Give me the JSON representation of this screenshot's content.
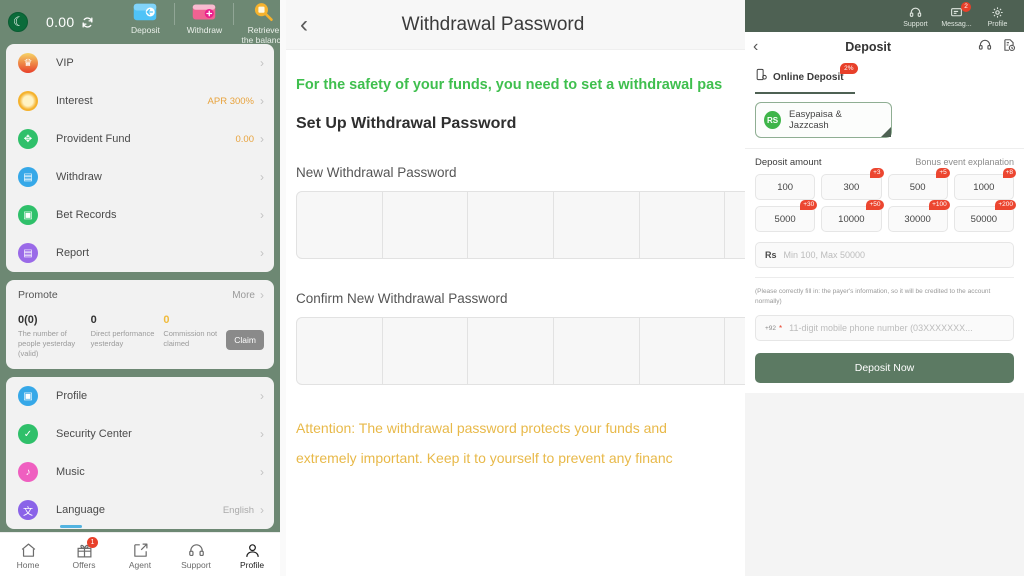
{
  "left_panel": {
    "topbar": {
      "flag_icon": "pakistan-flag-icon",
      "balance": "0.00",
      "refresh_icon": "refresh-icon",
      "actions": [
        {
          "label": "Deposit",
          "icon": "deposit-wallet-icon"
        },
        {
          "label": "Withdraw",
          "icon": "withdraw-card-icon"
        },
        {
          "label": "Retrieve\nthe balance",
          "label_line1": "Retrieve",
          "label_line2": "the balance",
          "icon": "retrieve-balance-icon"
        }
      ]
    },
    "menu_group_1": [
      {
        "label": "VIP",
        "icon": "vip-crown-icon",
        "value": "",
        "color": "#e8402a"
      },
      {
        "label": "Interest",
        "icon": "interest-coin-icon",
        "value": "APR 300%",
        "color": "#f0a93c"
      },
      {
        "label": "Provident Fund",
        "icon": "provident-fund-icon",
        "value": "0.00",
        "color": "#2fc06a"
      },
      {
        "label": "Withdraw",
        "icon": "withdraw-icon",
        "value": "",
        "color": "#36a8e8"
      },
      {
        "label": "Bet Records",
        "icon": "bet-records-icon",
        "value": "",
        "color": "#2fc06a"
      },
      {
        "label": "Report",
        "icon": "report-icon",
        "value": "",
        "color": "#9a6ae8"
      }
    ],
    "promote": {
      "title": "Promote",
      "more_label": "More",
      "stats": [
        {
          "value": "0(0)",
          "caption": "The number of people yesterday (valid)",
          "highlight": false
        },
        {
          "value": "0",
          "caption": "Direct performance yesterday",
          "highlight": false
        },
        {
          "value": "0",
          "caption": "Commission not claimed",
          "highlight": true
        }
      ],
      "claim_label": "Claim"
    },
    "menu_group_2": [
      {
        "label": "Profile",
        "icon": "profile-icon",
        "value": "",
        "color": "#36a8e8"
      },
      {
        "label": "Security Center",
        "icon": "security-shield-icon",
        "value": "",
        "color": "#2fc06a"
      },
      {
        "label": "Music",
        "icon": "music-note-icon",
        "value": "",
        "color": "#ef5fc0"
      },
      {
        "label": "Language",
        "icon": "language-icon",
        "value": "English",
        "color": "#8a63e8"
      }
    ],
    "bottom_nav": [
      {
        "label": "Home",
        "icon": "home-icon",
        "badge": "",
        "active": false
      },
      {
        "label": "Offers",
        "icon": "gift-icon",
        "badge": "1",
        "active": false
      },
      {
        "label": "Agent",
        "icon": "agent-share-icon",
        "badge": "",
        "active": false
      },
      {
        "label": "Support",
        "icon": "headset-icon",
        "badge": "",
        "active": false
      },
      {
        "label": "Profile",
        "icon": "person-icon",
        "badge": "",
        "active": true
      }
    ]
  },
  "mid_panel": {
    "back_icon": "back-chevron-icon",
    "title": "Withdrawal Password",
    "notice": "For the safety of your funds, you need to set a withdrawal pas",
    "heading": "Set Up Withdrawal Password",
    "new_password_label": "New Withdrawal Password",
    "confirm_password_label": "Confirm New Withdrawal Password",
    "otp_cells": 6,
    "warning_line1": "Attention: The withdrawal password protects your funds and",
    "warning_line2": "extremely important. Keep it to yourself to prevent any financ"
  },
  "right_panel": {
    "topbar": [
      {
        "label": "Support",
        "icon": "headset-icon",
        "badge": ""
      },
      {
        "label": "Messag...",
        "icon": "message-icon",
        "badge": "2"
      },
      {
        "label": "Profile",
        "icon": "gear-icon",
        "badge": ""
      }
    ],
    "back_icon": "back-chevron-icon",
    "title": "Deposit",
    "header_icons": [
      {
        "icon": "headset-icon"
      },
      {
        "icon": "deposit-history-icon"
      }
    ],
    "tab": {
      "label": "Online Deposit",
      "icon": "mobile-deposit-icon",
      "badge": "2%"
    },
    "method": {
      "label": "Easypaisa & Jazzcash",
      "icon": "rs-currency-icon",
      "badge": "RS",
      "selected": true
    },
    "deposit_amount_label": "Deposit amount",
    "bonus_link": "Bonus event explanation",
    "amounts": [
      {
        "value": "100",
        "bonus": ""
      },
      {
        "value": "300",
        "bonus": "+3"
      },
      {
        "value": "500",
        "bonus": "+5"
      },
      {
        "value": "1000",
        "bonus": "+8"
      },
      {
        "value": "5000",
        "bonus": "+30"
      },
      {
        "value": "10000",
        "bonus": "+50"
      },
      {
        "value": "30000",
        "bonus": "+100"
      },
      {
        "value": "50000",
        "bonus": "+200"
      }
    ],
    "amount_input": {
      "prefix": "Rs",
      "placeholder": "Min 100, Max 50000",
      "value": ""
    },
    "payer_hint": "(Please correctly fill in: the payer's information, so it will be credited to the account normally)",
    "phone_input": {
      "country_code": "+92",
      "required_mark": "*",
      "placeholder": "11-digit mobile phone number (03XXXXXXX...",
      "value": ""
    },
    "submit_label": "Deposit Now"
  },
  "colors": {
    "brand_green": "#6d8873",
    "dark_green": "#4e6153",
    "button_green": "#5c7a63",
    "accent_green": "#3fbf4e",
    "warn_yellow": "#e8b949",
    "badge_red": "#e8402a"
  }
}
